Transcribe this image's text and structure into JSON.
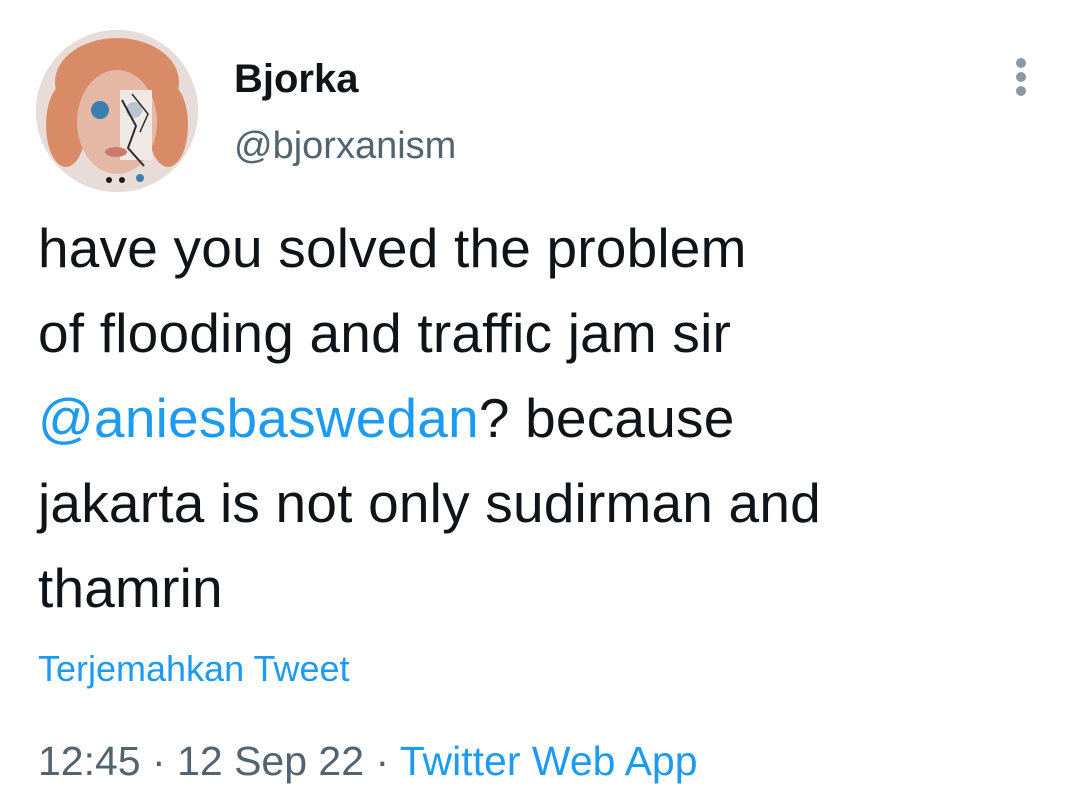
{
  "author": {
    "display_name": "Bjorka",
    "handle": "@bjorxanism",
    "avatar_icon": "profile-avatar"
  },
  "menu": {
    "icon": "more-vertical-icon"
  },
  "tweet": {
    "line1": "have you solved the problem",
    "line2": "of flooding and traffic jam sir",
    "mention": "@aniesbaswedan",
    "line3_rest": "? because",
    "line4": "jakarta is not only sudirman and",
    "line5": "thamrin"
  },
  "translate_label": "Terjemahkan Tweet",
  "meta": {
    "time": "12:45",
    "separator": "·",
    "date": "12 Sep 22",
    "source": "Twitter Web App"
  },
  "colors": {
    "link": "#1d9bf0",
    "text": "#0f1419",
    "secondary": "#536471"
  }
}
